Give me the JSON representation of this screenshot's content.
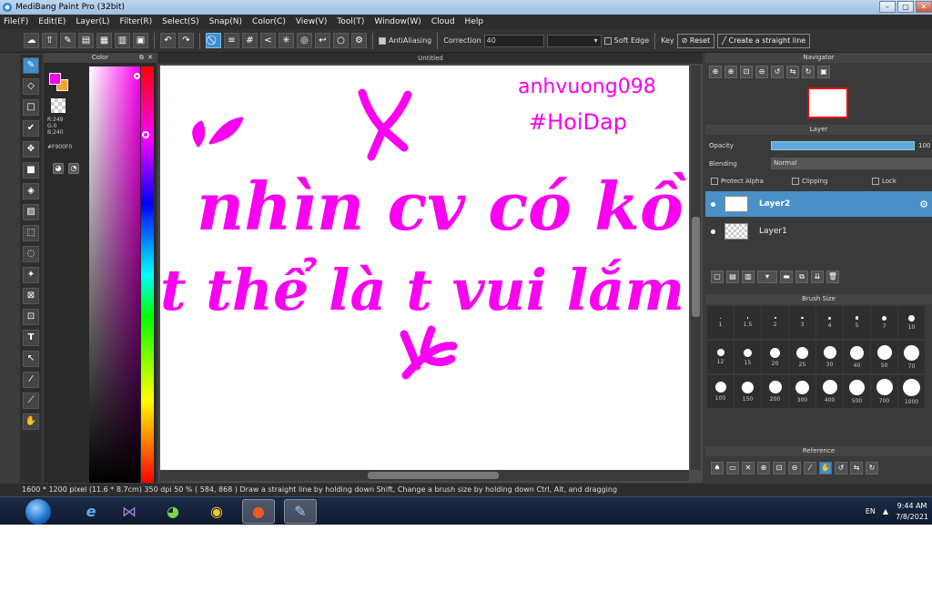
{
  "app": {
    "title": "MediBang Paint Pro (32bit)"
  },
  "window_buttons": {
    "minimize": "–",
    "maximize": "▢",
    "close": "✕"
  },
  "menu": [
    "File(F)",
    "Edit(E)",
    "Layer(L)",
    "Filter(R)",
    "Select(S)",
    "Snap(N)",
    "Color(C)",
    "View(V)",
    "Tool(T)",
    "Window(W)",
    "Cloud",
    "Help"
  ],
  "toolbar": {
    "antialias_label": "AntiAliasing",
    "correction_label": "Correction",
    "correction_value": "40",
    "soft_edge_label": "Soft Edge",
    "key_label": "Key",
    "reset_label": "Reset",
    "straight_line_label": "Create a straight line"
  },
  "color_panel": {
    "title": "Color",
    "r": "R:249",
    "g": "G:0",
    "b": "B:240",
    "hex": "#F900F0"
  },
  "document": {
    "tab_title": "Untitled"
  },
  "navigator": {
    "title": "Navigator"
  },
  "layer_panel": {
    "title": "Layer",
    "opacity_label": "Opacity",
    "opacity_value": "100",
    "blending_label": "Blending",
    "blending_value": "Normal",
    "protect_alpha": "Protect Alpha",
    "clipping": "Clipping",
    "lock": "Lock",
    "layers": [
      {
        "name": "Layer2",
        "selected": true
      },
      {
        "name": "Layer1",
        "selected": false
      }
    ]
  },
  "brush_size": {
    "title": "Brush Size",
    "sizes": [
      "1",
      "1.5",
      "2",
      "3",
      "4",
      "5",
      "7",
      "10",
      "12",
      "15",
      "20",
      "25",
      "30",
      "40",
      "50",
      "70",
      "100",
      "150",
      "200",
      "300",
      "400",
      "500",
      "700",
      "1000"
    ]
  },
  "reference": {
    "title": "Reference"
  },
  "canvas_text": {
    "signature": "anhvuong098",
    "hashtag": "#HoiDap",
    "line1": "nhìn cv có kồ",
    "line2": "t thể là t vui lắm"
  },
  "status": {
    "text": "1600 * 1200 pixel  (11.6 * 8.7cm)  350 dpi  50 %  ( 584, 868 )  Draw a straight line by holding down Shift, Change a brush size by holding down Ctrl, Alt, and dragging"
  },
  "taskbar": {
    "lang": "EN",
    "time": "9:44 AM",
    "date": "7/8/2021"
  },
  "colors": {
    "accent": "#3e8ed0",
    "brush": "#F900F0"
  }
}
